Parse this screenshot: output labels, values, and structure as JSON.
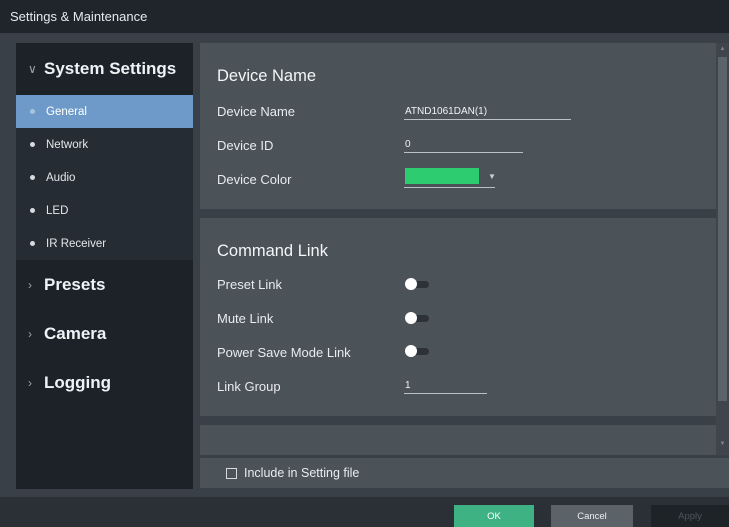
{
  "window": {
    "title": "Settings & Maintenance"
  },
  "sidebar": {
    "groups": [
      {
        "label": "System Settings",
        "expanded": true
      },
      {
        "label": "Presets",
        "expanded": false
      },
      {
        "label": "Camera",
        "expanded": false
      },
      {
        "label": "Logging",
        "expanded": false
      }
    ],
    "items": [
      {
        "label": "General",
        "active": true
      },
      {
        "label": "Network"
      },
      {
        "label": "Audio"
      },
      {
        "label": "LED"
      },
      {
        "label": "IR Receiver"
      }
    ]
  },
  "device_name_section": {
    "title": "Device Name",
    "rows": [
      {
        "label": "Device Name",
        "value": "ATND1061DAN(1)"
      },
      {
        "label": "Device ID",
        "value": "0"
      },
      {
        "label": "Device Color",
        "color": "#2ecc71"
      }
    ]
  },
  "command_link_section": {
    "title": "Command Link",
    "rows": [
      {
        "label": "Preset Link",
        "state": "off"
      },
      {
        "label": "Mute Link",
        "state": "off"
      },
      {
        "label": "Power Save Mode Link",
        "state": "off"
      },
      {
        "label": "Link Group",
        "value": "1"
      }
    ]
  },
  "include": {
    "label": "Include in Setting file",
    "checked": false
  },
  "footer": {
    "ok": "OK",
    "cancel": "Cancel",
    "apply": "Apply"
  },
  "colors": {
    "accent": "#6e9ac9",
    "ok_button": "#3fb283",
    "device_color": "#2ecc71"
  }
}
